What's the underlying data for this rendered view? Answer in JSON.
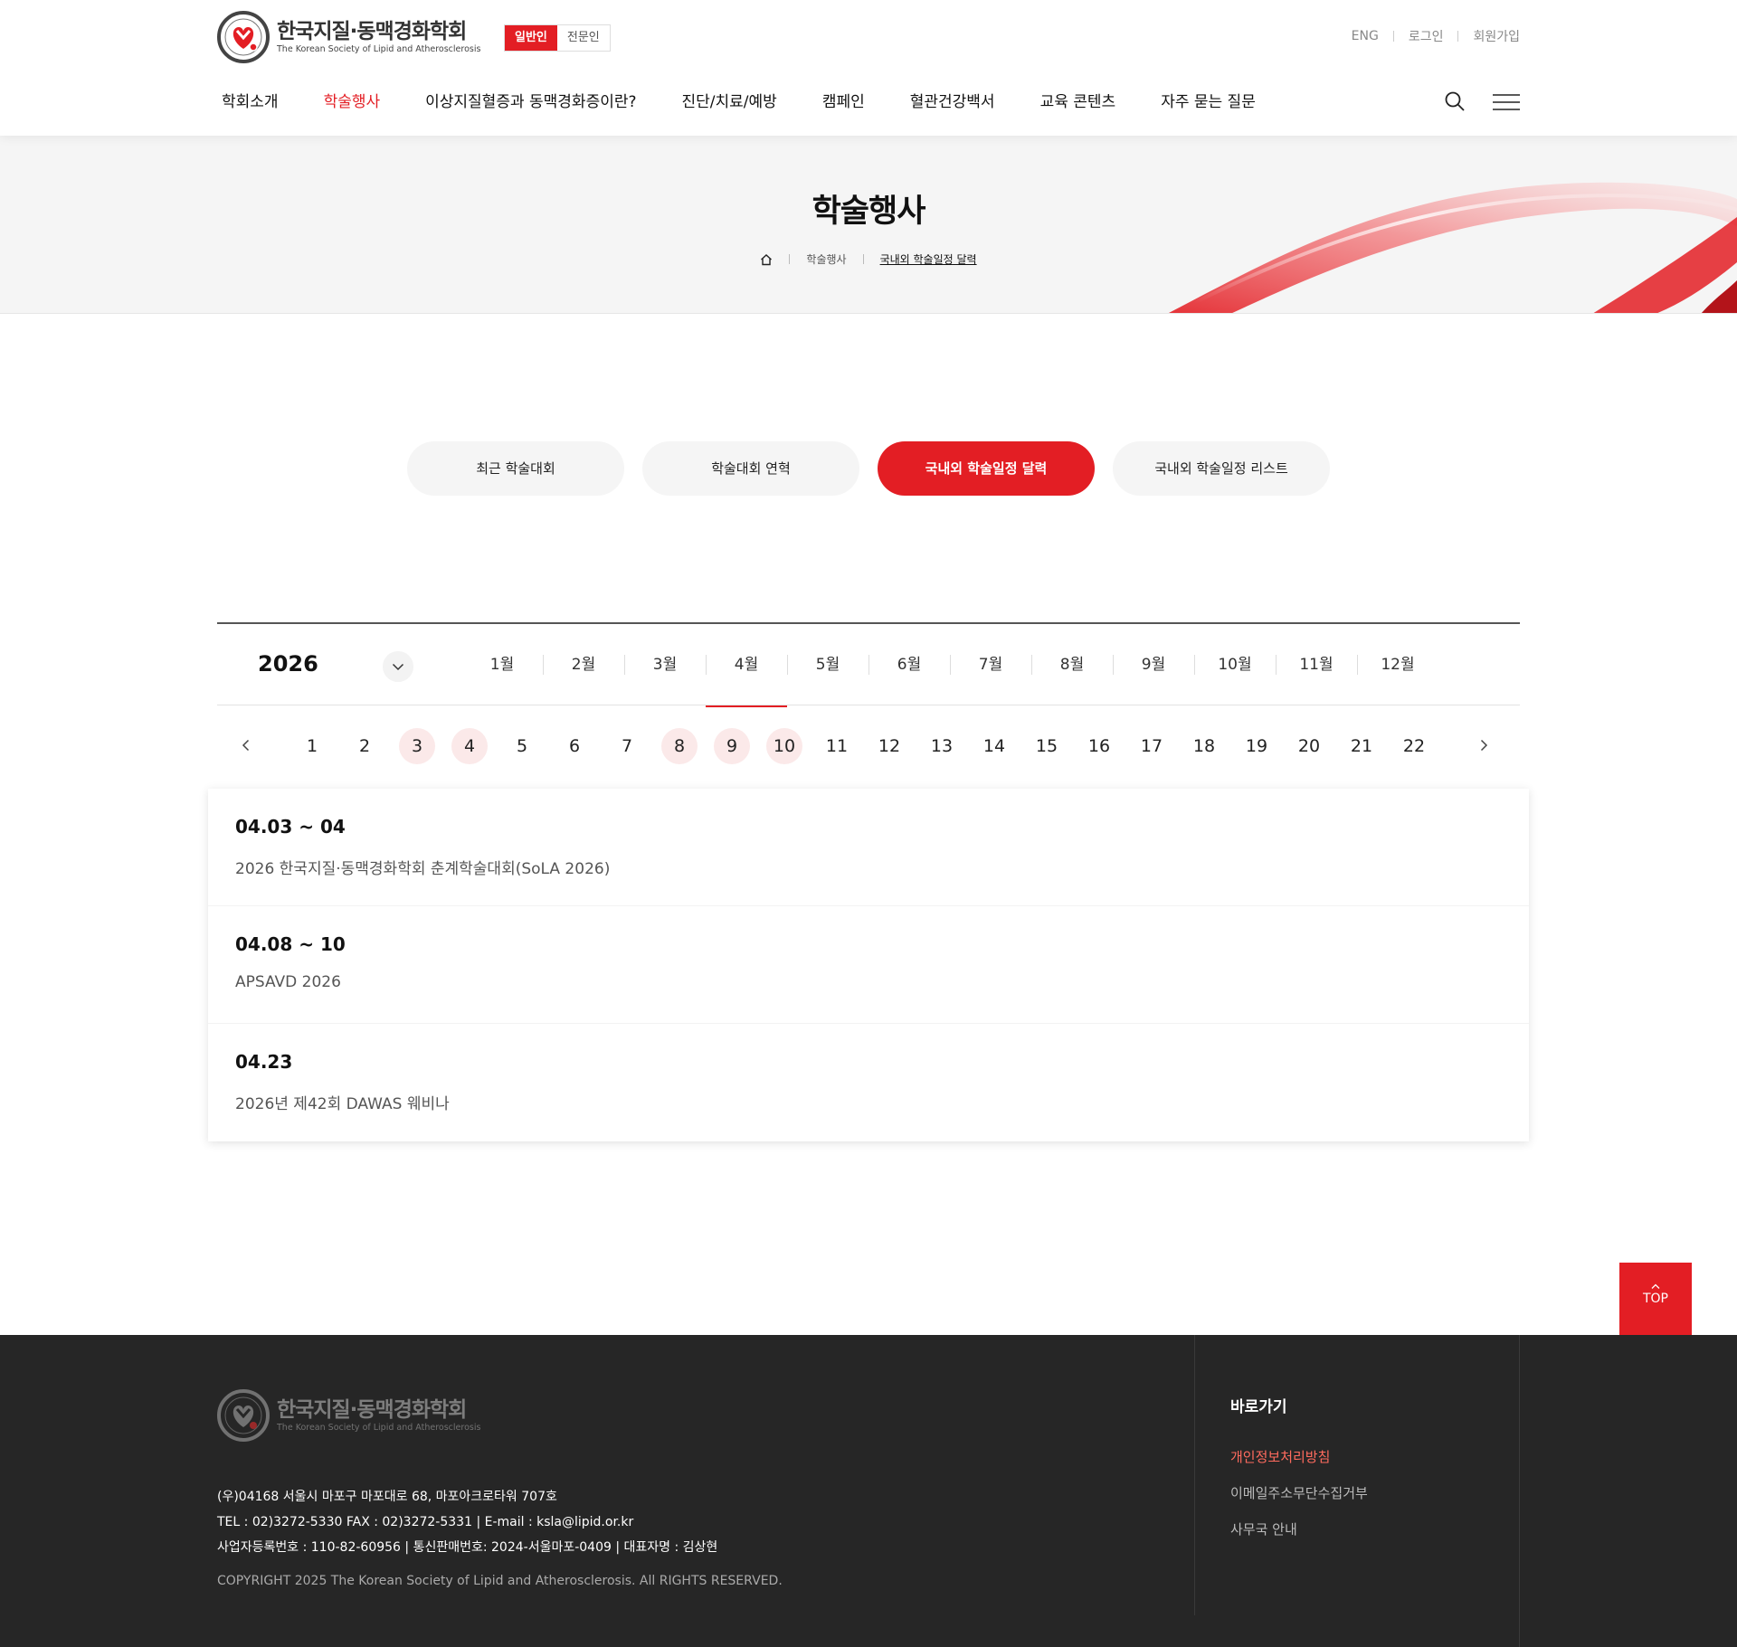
{
  "header": {
    "logo_ko": "한국지질·동맥경화학회",
    "logo_en": "The Korean Society of Lipid and Atherosclerosis",
    "audience_toggle": {
      "general": "일반인",
      "expert": "전문인",
      "selected": "일반인"
    },
    "util": {
      "eng": "ENG",
      "login": "로그인",
      "signup": "회원가입"
    },
    "nav": [
      {
        "label": "학회소개",
        "active": false
      },
      {
        "label": "학술행사",
        "active": true
      },
      {
        "label": "이상지질혈증과 동맥경화증이란?",
        "active": false
      },
      {
        "label": "진단/치료/예방",
        "active": false
      },
      {
        "label": "캠페인",
        "active": false
      },
      {
        "label": "혈관건강백서",
        "active": false
      },
      {
        "label": "교육 콘텐츠",
        "active": false
      },
      {
        "label": "자주 묻는 질문",
        "active": false
      }
    ]
  },
  "subvisual": {
    "title": "학술행사",
    "breadcrumb": [
      "학술행사",
      "국내외 학술일정 달력"
    ]
  },
  "tabs": [
    {
      "label": "최근 학술대회",
      "active": false
    },
    {
      "label": "학술대회 연혁",
      "active": false
    },
    {
      "label": "국내외 학술일정 달력",
      "active": true
    },
    {
      "label": "국내외 학술일정 리스트",
      "active": false
    }
  ],
  "calendar": {
    "year": "2026",
    "months": [
      "1월",
      "2월",
      "3월",
      "4월",
      "5월",
      "6월",
      "7월",
      "8월",
      "9월",
      "10월",
      "11월",
      "12월"
    ],
    "active_month": "4월",
    "days": [
      "1",
      "2",
      "3",
      "4",
      "5",
      "6",
      "7",
      "8",
      "9",
      "10",
      "11",
      "12",
      "13",
      "14",
      "15",
      "16",
      "17",
      "18",
      "19",
      "20",
      "21",
      "22"
    ],
    "event_days": [
      "3",
      "4",
      "8",
      "9",
      "10"
    ]
  },
  "events": [
    {
      "date": "04.03 ~ 04",
      "title": "2026 한국지질·동맥경화학회 춘계학술대회(SoLA 2026)"
    },
    {
      "date": "04.08 ~ 10",
      "title": "APSAVD 2026"
    },
    {
      "date": "04.23",
      "title": "2026년 제42회 DAWAS 웨비나"
    }
  ],
  "top_button": "TOP",
  "footer": {
    "logo_ko": "한국지질·동맥경화학회",
    "logo_en": "The Korean Society of Lipid and Atherosclerosis",
    "address": "(우)04168 서울시 마포구 마포대로 68, 마포아크로타워 707호",
    "contact": "TEL : 02)3272-5330 FAX : 02)3272-5331   |   E-mail : ksla@lipid.or.kr",
    "business": "사업자등록번호 : 110-82-60956   |   통신판매번호: 2024-서울마포-0409   |   대표자명 : 김상현",
    "copyright": "COPYRIGHT 2025 The Korean Society of Lipid and Atherosclerosis. All RIGHTS RESERVED.",
    "links_title": "바로가기",
    "links": [
      "개인정보처리방침",
      "이메일주소무단수집거부",
      "사무국 안내"
    ]
  },
  "colors": {
    "accent": "#e31e24",
    "event_day_bg": "#fbe9e9",
    "footer_bg": "#262626",
    "link_highlight": "#ff6b5e"
  }
}
